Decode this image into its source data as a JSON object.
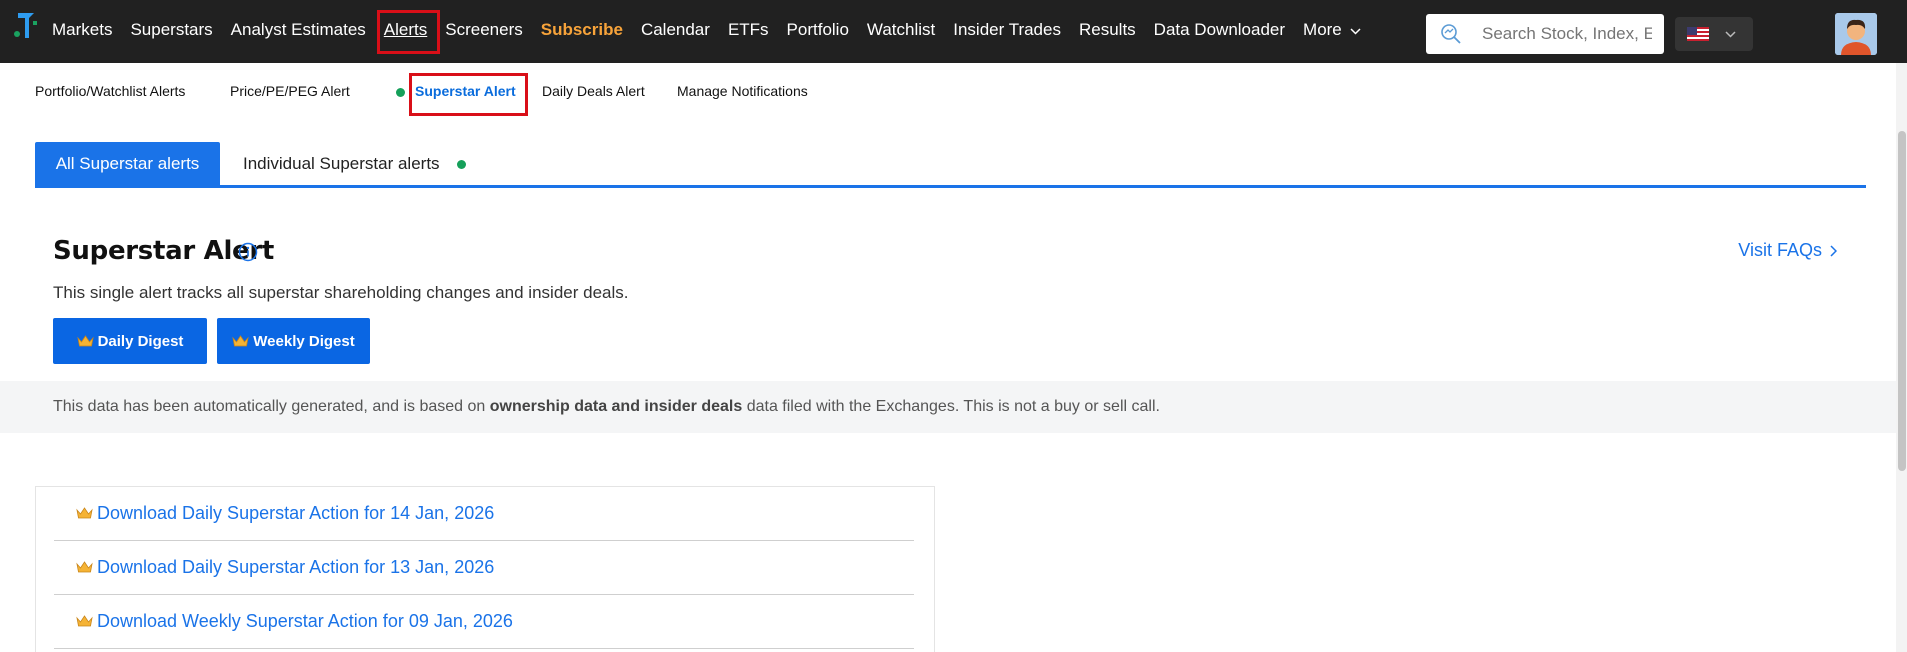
{
  "topnav": {
    "items": [
      {
        "label": "Markets"
      },
      {
        "label": "Superstars"
      },
      {
        "label": "Analyst Estimates"
      },
      {
        "label": "Alerts"
      },
      {
        "label": "Screeners"
      },
      {
        "label": "Subscribe"
      },
      {
        "label": "Calendar"
      },
      {
        "label": "ETFs"
      },
      {
        "label": "Portfolio"
      },
      {
        "label": "Watchlist"
      },
      {
        "label": "Insider Trades"
      },
      {
        "label": "Results"
      },
      {
        "label": "Data Downloader"
      }
    ],
    "more_label": "More",
    "search_placeholder": "Search Stock, Index, ETF",
    "accent_active": "#d90f18",
    "subscribe_color": "#f7a33a"
  },
  "subnav": {
    "items": [
      {
        "label": "Portfolio/Watchlist Alerts"
      },
      {
        "label": "Price/PE/PEG Alert"
      },
      {
        "label": "Superstar Alert"
      },
      {
        "label": "Daily Deals Alert"
      },
      {
        "label": "Manage Notifications"
      }
    ]
  },
  "tabs": {
    "all": "All Superstar alerts",
    "individual": "Individual Superstar alerts"
  },
  "header": {
    "title": "Superstar Alert",
    "faq": "Visit FAQs",
    "description": "This single alert tracks all superstar shareholding changes and insider deals.",
    "daily_btn": "Daily Digest",
    "weekly_btn": "Weekly Digest"
  },
  "disclaimer": {
    "before": "This data has been automatically generated, and is based on ",
    "bold": "ownership data and insider deals",
    "after": " data filed with the Exchanges. This is not a buy or sell call."
  },
  "downloads": [
    {
      "label": "Download Daily Superstar Action for 14 Jan, 2026"
    },
    {
      "label": "Download Daily Superstar Action for 13 Jan, 2026"
    },
    {
      "label": "Download Weekly Superstar Action for 09 Jan, 2026"
    }
  ],
  "colors": {
    "brand_blue": "#1a73e8",
    "nav_bg": "#212121",
    "status_green": "#15a05a"
  }
}
